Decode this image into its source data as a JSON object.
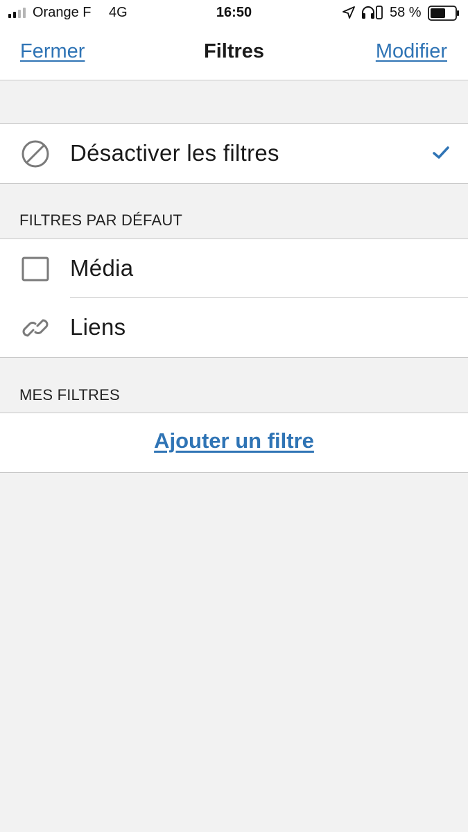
{
  "status_bar": {
    "carrier": "Orange F",
    "network": "4G",
    "time": "16:50",
    "battery": "58 %",
    "icons": [
      "signal-icon",
      "location-icon",
      "headphones-icon",
      "rotation-lock-icon",
      "battery-icon"
    ]
  },
  "nav": {
    "left": "Fermer",
    "title": "Filtres",
    "right": "Modifier"
  },
  "disable_row": {
    "label": "Désactiver les filtres",
    "icon": "prohibited-icon",
    "checked": true
  },
  "default_filters": {
    "header": "FILTRES PAR DÉFAUT",
    "items": [
      {
        "label": "Média",
        "icon": "square-icon"
      },
      {
        "label": "Liens",
        "icon": "link-icon"
      }
    ]
  },
  "my_filters": {
    "header": "MES FILTRES",
    "add_label": "Ajouter un filtre"
  },
  "colors": {
    "accent": "#2f74b5",
    "background": "#f2f2f2",
    "icon_gray": "#7a7a7a"
  }
}
